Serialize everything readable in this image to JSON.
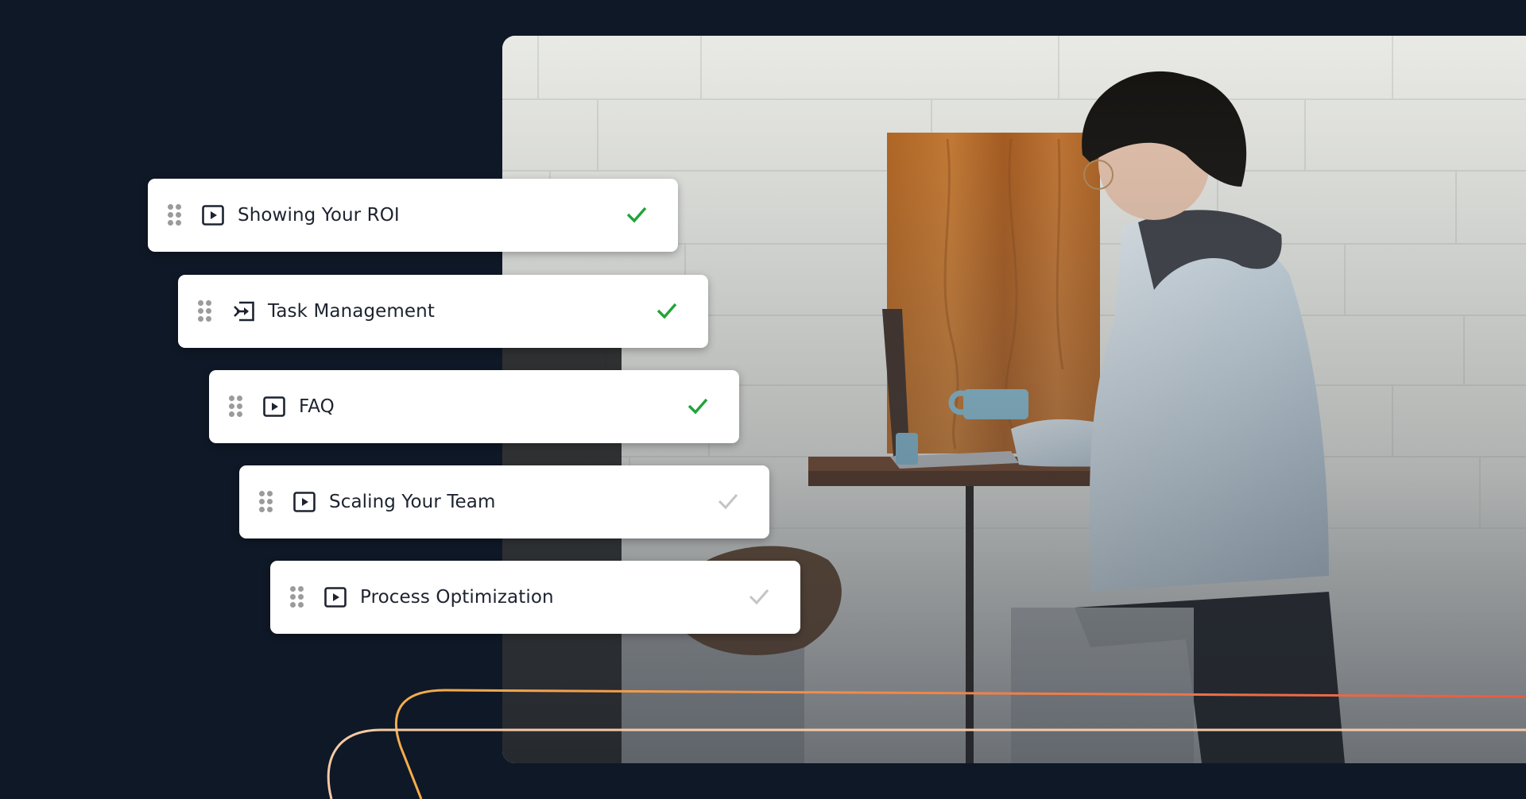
{
  "theme": {
    "background": "#0f1826",
    "card_background": "#ffffff",
    "text_color": "#1d2330",
    "handle_color": "#9b9b9b",
    "check_complete_color": "#22a33a",
    "check_incomplete_color": "#c4c4c4",
    "line_upper_gradient": [
      "#f5ad4c",
      "#ea5a44"
    ],
    "line_lower_color": "#f6c9a5"
  },
  "lessons": [
    {
      "title": "Showing Your ROI",
      "icon": "play-video-icon",
      "completed": true
    },
    {
      "title": "Task Management",
      "icon": "enter-arrow-icon",
      "completed": true
    },
    {
      "title": "FAQ",
      "icon": "play-video-icon",
      "completed": true
    },
    {
      "title": "Scaling Your Team",
      "icon": "play-video-icon",
      "completed": false
    },
    {
      "title": "Process Optimization",
      "icon": "play-video-icon",
      "completed": false
    }
  ],
  "hero_image": {
    "description": "Person in denim jacket typing on laptop at cafe table against white brick wall",
    "icon": "photo"
  }
}
